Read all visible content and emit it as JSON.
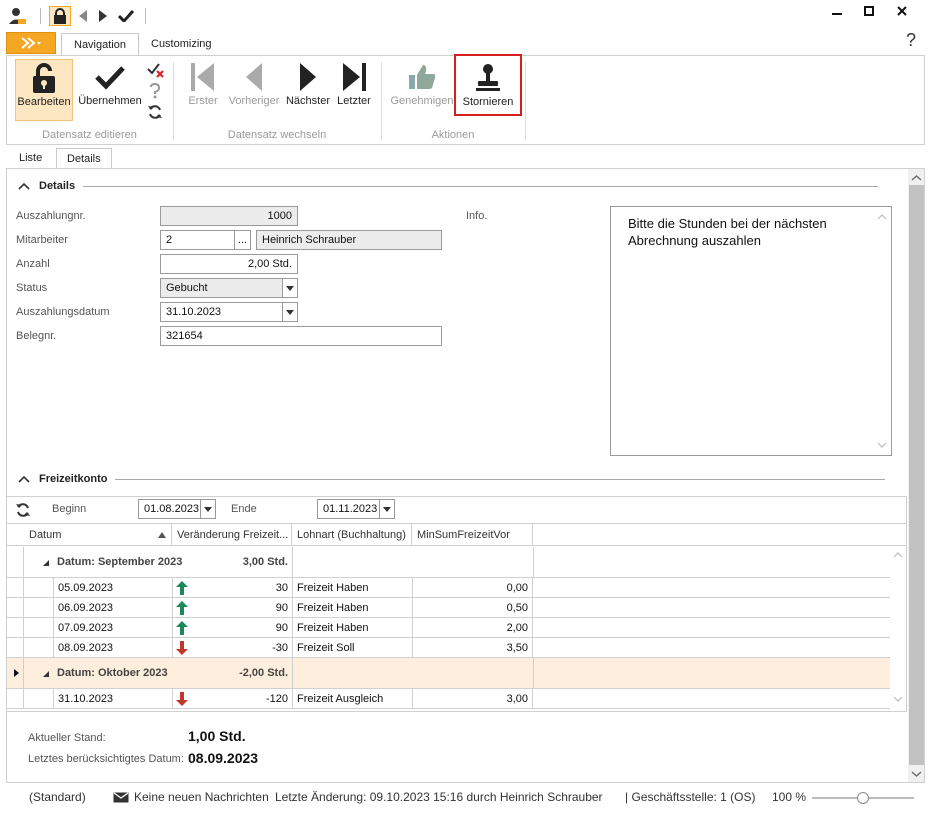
{
  "ribbon": {
    "tabs": [
      "Navigation",
      "Customizing"
    ],
    "help": "?",
    "groups": [
      {
        "label": "Datensatz editieren"
      },
      {
        "label": "Datensatz wechseln"
      },
      {
        "label": "Aktionen"
      }
    ],
    "buttons": {
      "edit": "Bearbeiten",
      "accept": "Übernehmen",
      "first": "Erster",
      "prev": "Vorheriger",
      "next": "Nächster",
      "last": "Letzter",
      "approve": "Genehmigen",
      "cancel": "Stornieren"
    }
  },
  "subtabs": [
    "Liste",
    "Details"
  ],
  "details": {
    "section_title": "Details",
    "labels": {
      "nr": "Auszahlungnr.",
      "employee": "Mitarbeiter",
      "count": "Anzahl",
      "status": "Status",
      "date": "Auszahlungsdatum",
      "receipt": "Belegnr.",
      "info": "Info."
    },
    "values": {
      "nr": "1000",
      "employee_id": "2",
      "employee_btn": "...",
      "employee_name": "Heinrich Schrauber",
      "count": "2,00 Std.",
      "status": "Gebucht",
      "date": "31.10.2023",
      "receipt": "321654",
      "info_text": "Bitte die Stunden bei der nächsten Abrechnung auszahlen"
    }
  },
  "freizeit": {
    "section_title": "Freizeitkonto",
    "begin_label": "Beginn",
    "begin": "01.08.2023",
    "end_label": "Ende",
    "end": "01.11.2023",
    "columns": [
      "Datum",
      "Veränderung Freizeit...",
      "Lohnart (Buchhaltung)",
      "MinSumFreizeitVor"
    ],
    "groups": [
      {
        "label": "Datum: September 2023",
        "total": "3,00 Std.",
        "rows": [
          {
            "date": "05.09.2023",
            "dir": "up",
            "change": "30",
            "type": "Freizeit Haben",
            "min": "0,00"
          },
          {
            "date": "06.09.2023",
            "dir": "up",
            "change": "90",
            "type": "Freizeit Haben",
            "min": "0,50"
          },
          {
            "date": "07.09.2023",
            "dir": "up",
            "change": "90",
            "type": "Freizeit Haben",
            "min": "2,00"
          },
          {
            "date": "08.09.2023",
            "dir": "down",
            "change": "-30",
            "type": "Freizeit Soll",
            "min": "3,50"
          }
        ]
      },
      {
        "label": "Datum: Oktober 2023",
        "total": "-2,00 Std.",
        "rows": [
          {
            "date": "31.10.2023",
            "dir": "down",
            "change": "-120",
            "type": "Freizeit Ausgleich",
            "min": "3,00"
          }
        ]
      }
    ],
    "current_label": "Aktueller Stand:",
    "current_value": "1,00 Std.",
    "last_label": "Letztes berücksichtigtes Datum:",
    "last_value": "08.09.2023"
  },
  "status": {
    "layout": "(Standard)",
    "messages": "Keine neuen Nachrichten",
    "last_change": "Letzte Änderung: 09.10.2023 15:16 durch Heinrich Schrauber",
    "branch": "| Geschäftsstelle:  1 (OS)",
    "zoom": "100 %",
    "zoom_level": 0.5
  },
  "colors": {
    "accent": "#f5a623",
    "up": "#1a8a5a",
    "down": "#c0392b",
    "highlight": "#d62020",
    "group_active": "#fdeedd"
  }
}
